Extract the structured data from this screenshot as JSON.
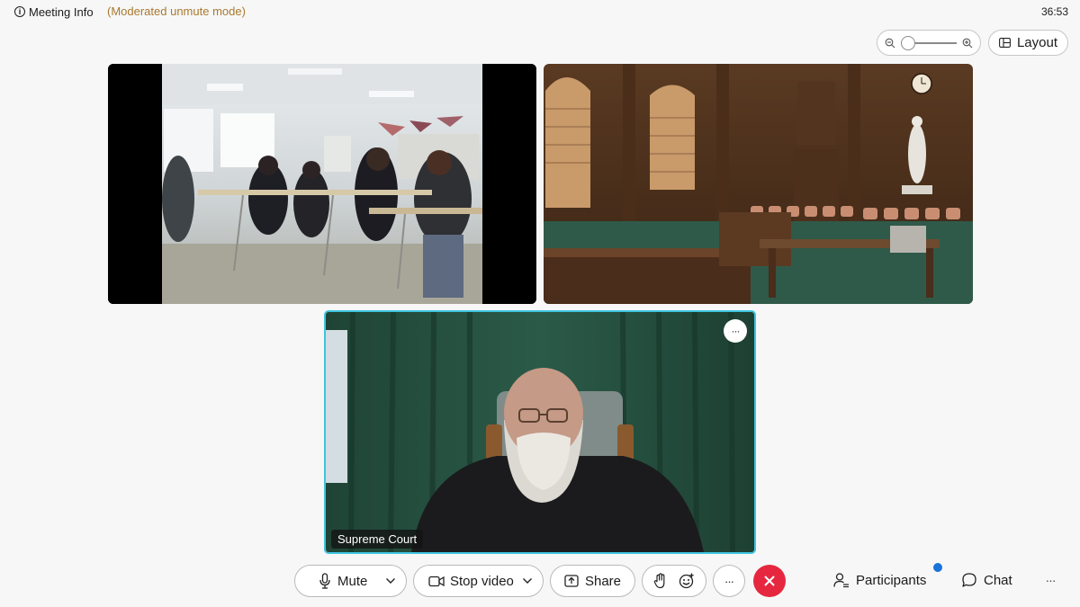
{
  "topbar": {
    "meeting_info_label": "Meeting Info",
    "mode_label": "(Moderated unmute mode)",
    "clock": "36:53"
  },
  "view": {
    "layout_label": "Layout",
    "zoom_level": 0.0
  },
  "videos": [
    {
      "id": "classroom",
      "name": ""
    },
    {
      "id": "courtroom",
      "name": ""
    },
    {
      "id": "judge",
      "name": "Supreme Court",
      "active_speaker": true,
      "more_label": "···"
    }
  ],
  "controls": {
    "mute_label": "Mute",
    "stop_video_label": "Stop video",
    "share_label": "Share",
    "more_label": "···",
    "participants_label": "Participants",
    "chat_label": "Chat",
    "overflow_label": "···"
  },
  "icons": [
    "info-icon",
    "zoom-out-icon",
    "zoom-in-icon",
    "layout-icon",
    "microphone-icon",
    "chevron-down-icon",
    "video-camera-icon",
    "share-screen-icon",
    "raise-hand-icon",
    "reactions-icon",
    "end-call-icon",
    "participants-icon",
    "chat-icon"
  ],
  "colors": {
    "accent_border": "#3fc4df",
    "mode_text": "#a8792e",
    "end_call": "#e5283f",
    "notification": "#1a73d9"
  }
}
